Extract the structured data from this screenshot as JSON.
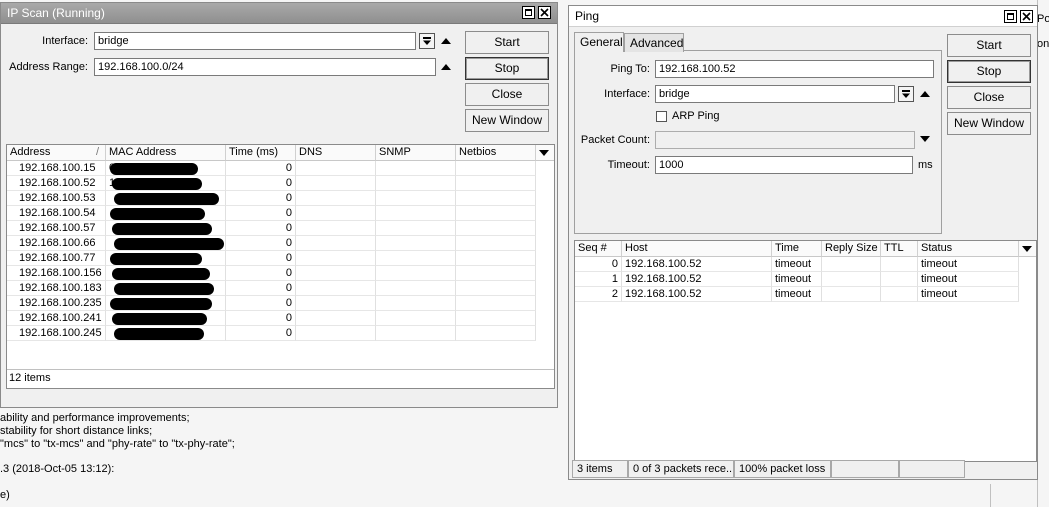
{
  "background": {
    "lines": [
      "ability and performance improvements;",
      "stability for short distance links;",
      "\"mcs\" to \"tx-mcs\" and \"phy-rate\" to \"tx-phy-rate\";",
      ".3 (2018-Oct-05 13:12):",
      "e)"
    ],
    "right_fragments": [
      "Po",
      "onl"
    ]
  },
  "ip_scan": {
    "title": "IP Scan (Running)",
    "title_color": "#ffffff",
    "interface_label": "Interface:",
    "interface_value": "bridge",
    "address_range_label": "Address Range:",
    "address_range_value": "192.168.100.0/24",
    "buttons": {
      "start": "Start",
      "stop": "Stop",
      "close": "Close",
      "new_window": "New Window"
    },
    "columns": [
      "Address",
      "MAC Address",
      "Time (ms)",
      "DNS",
      "SNMP",
      "Netbios"
    ],
    "rows": [
      {
        "address": "192.168.100.15",
        "mac": "0",
        "time": "0"
      },
      {
        "address": "192.168.100.52",
        "mac": "1",
        "time": "0"
      },
      {
        "address": "192.168.100.53",
        "mac": "",
        "time": "0"
      },
      {
        "address": "192.168.100.54",
        "mac": "",
        "time": "0"
      },
      {
        "address": "192.168.100.57",
        "mac": "",
        "time": "0"
      },
      {
        "address": "192.168.100.66",
        "mac": "",
        "time": "0"
      },
      {
        "address": "192.168.100.77",
        "mac": "",
        "time": "0"
      },
      {
        "address": "192.168.100.156",
        "mac": "",
        "time": "0"
      },
      {
        "address": "192.168.100.183",
        "mac": "",
        "time": "0"
      },
      {
        "address": "192.168.100.235",
        "mac": "",
        "time": "0"
      },
      {
        "address": "192.168.100.241",
        "mac": "",
        "time": "0"
      },
      {
        "address": "192.168.100.245",
        "mac": "",
        "time": "0"
      }
    ],
    "status": "12 items"
  },
  "ping": {
    "title": "Ping",
    "title_bar_color": "#ffffff",
    "tabs": [
      "General",
      "Advanced"
    ],
    "ping_to_label": "Ping To:",
    "ping_to_value": "192.168.100.52",
    "interface_label": "Interface:",
    "interface_value": "bridge",
    "arp_ping_label": "ARP Ping",
    "packet_count_label": "Packet Count:",
    "packet_count_value": "",
    "timeout_label": "Timeout:",
    "timeout_value": "1000",
    "timeout_unit": "ms",
    "buttons": {
      "start": "Start",
      "stop": "Stop",
      "close": "Close",
      "new_window": "New Window"
    },
    "columns": [
      "Seq #",
      "Host",
      "Time",
      "Reply Size",
      "TTL",
      "Status"
    ],
    "rows": [
      {
        "seq": "0",
        "host": "192.168.100.52",
        "time": "timeout",
        "reply_size": "",
        "ttl": "",
        "status": "timeout"
      },
      {
        "seq": "1",
        "host": "192.168.100.52",
        "time": "timeout",
        "reply_size": "",
        "ttl": "",
        "status": "timeout"
      },
      {
        "seq": "2",
        "host": "192.168.100.52",
        "time": "timeout",
        "reply_size": "",
        "ttl": "",
        "status": "timeout"
      }
    ],
    "status": [
      "3 items",
      "0 of 3 packets rece...",
      "100% packet loss",
      "",
      ""
    ]
  }
}
